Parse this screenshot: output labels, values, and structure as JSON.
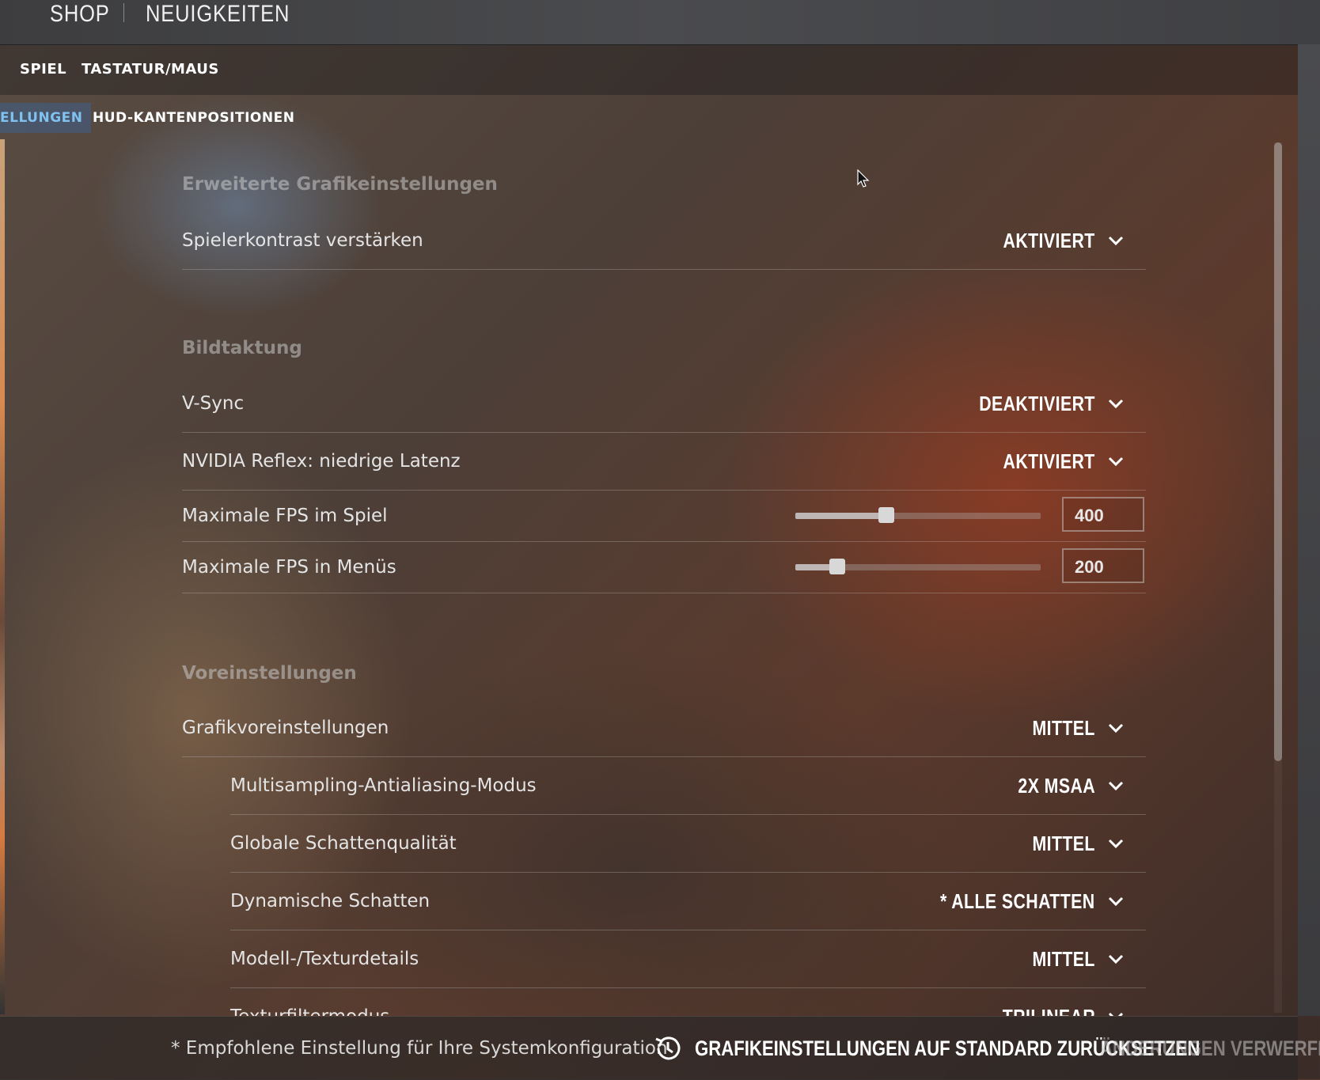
{
  "topnav": {
    "shop": "SHOP",
    "news": "NEUIGKEITEN"
  },
  "tabs_primary": [
    "SPIEL",
    "TASTATUR/MAUS"
  ],
  "tabs_secondary": {
    "active": "ELLUNGEN",
    "hud": "HUD-KANTENPOSITIONEN"
  },
  "sections": {
    "advanced": {
      "title": "Erweiterte Grafikeinstellungen",
      "player_contrast": {
        "label": "Spielerkontrast verstärken",
        "value": "AKTIVIERT"
      }
    },
    "framerate": {
      "title": "Bildtaktung",
      "vsync": {
        "label": "V-Sync",
        "value": "DEAKTIVIERT"
      },
      "reflex": {
        "label": "NVIDIA Reflex: niedrige Latenz",
        "value": "AKTIVIERT"
      },
      "fps_game": {
        "label": "Maximale FPS im Spiel",
        "value": "400",
        "slider_fraction": 0.37
      },
      "fps_menu": {
        "label": "Maximale FPS in Menüs",
        "value": "200",
        "slider_fraction": 0.17
      }
    },
    "presets": {
      "title": "Voreinstellungen",
      "preset": {
        "label": "Grafikvoreinstellungen",
        "value": "MITTEL"
      },
      "msaa": {
        "label": "Multisampling-Antialiasing-Modus",
        "value": "2X MSAA"
      },
      "shadow_quality": {
        "label": "Globale Schattenqualität",
        "value": "MITTEL"
      },
      "dynamic_shadows": {
        "label": "Dynamische Schatten",
        "value": "* ALLE SCHATTEN"
      },
      "model_texture": {
        "label": "Modell-/Texturdetails",
        "value": "MITTEL"
      },
      "texture_filter": {
        "label": "Texturfiltermodus",
        "value": "TRILINEAR"
      }
    }
  },
  "footer": {
    "note": "* Empfohlene Einstellung für Ihre Systemkonfiguration",
    "reset": "GRAFIKEINSTELLUNGEN AUF STANDARD ZURÜCKSETZEN",
    "discard": "ÄNDERUNGEN VERWERFEN"
  },
  "colors": {
    "accent": "#7fc2f0",
    "tab_active_bg": "#465a78"
  }
}
